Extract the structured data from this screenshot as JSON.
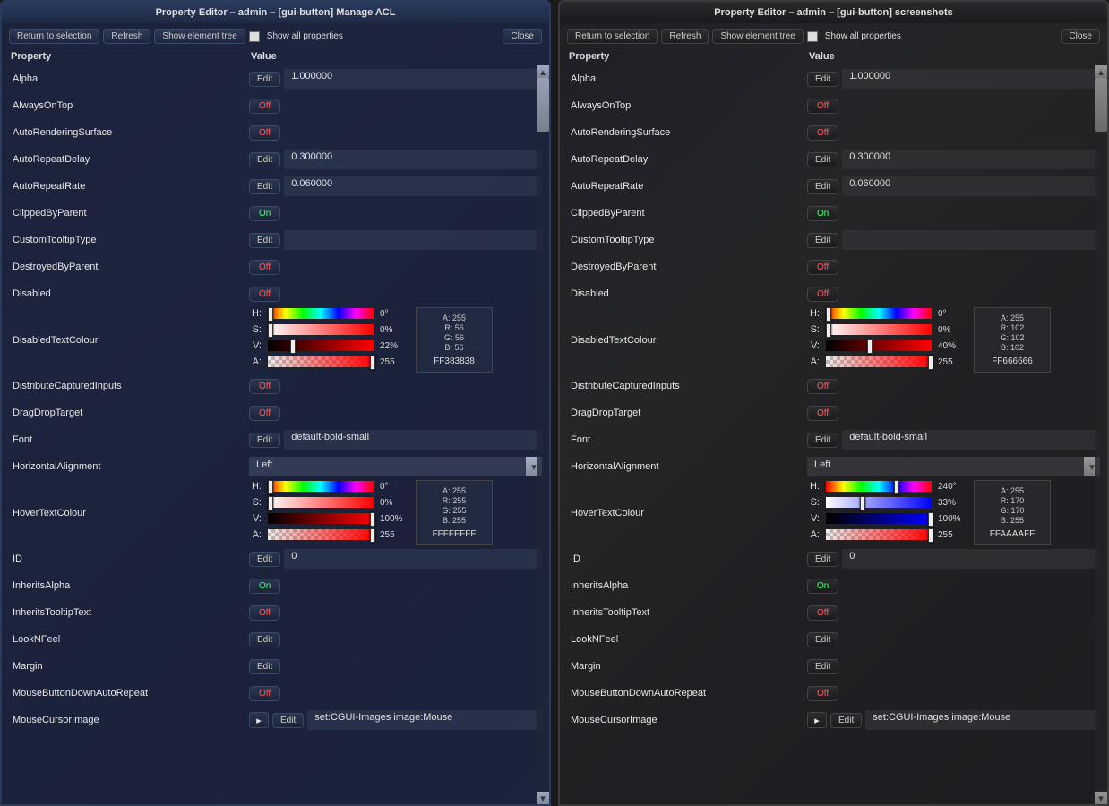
{
  "windows": [
    {
      "title": "Property Editor – admin – [gui-button] Manage ACL",
      "theme": "a",
      "toolbar": {
        "return": "Return to selection",
        "refresh": "Refresh",
        "tree": "Show element tree",
        "close": "Close",
        "showall": "Show all properties"
      },
      "headers": {
        "prop": "Property",
        "val": "Value"
      },
      "rows": [
        {
          "name": "Alpha",
          "type": "edit",
          "value": "1.000000"
        },
        {
          "name": "AlwaysOnTop",
          "type": "toggle",
          "state": "Off"
        },
        {
          "name": "AutoRenderingSurface",
          "type": "toggle",
          "state": "Off"
        },
        {
          "name": "AutoRepeatDelay",
          "type": "edit",
          "value": "0.300000"
        },
        {
          "name": "AutoRepeatRate",
          "type": "edit",
          "value": "0.060000"
        },
        {
          "name": "ClippedByParent",
          "type": "toggle",
          "state": "On"
        },
        {
          "name": "CustomTooltipType",
          "type": "edit",
          "value": ""
        },
        {
          "name": "DestroyedByParent",
          "type": "toggle",
          "state": "Off"
        },
        {
          "name": "Disabled",
          "type": "toggle",
          "state": "Off"
        },
        {
          "name": "DisabledTextColour",
          "type": "color",
          "h": {
            "val": "0°",
            "pos": 0
          },
          "s": {
            "val": "0%",
            "pos": 0
          },
          "v": {
            "val": "22%",
            "pos": 22
          },
          "a": {
            "val": "255",
            "pos": 100
          },
          "argb": {
            "a": "A: 255",
            "r": "R:   56",
            "g": "G:   56",
            "b": "B:   56"
          },
          "hex": "FF383838",
          "sgrad": "linear-gradient(90deg,#fff,#ff0000)",
          "vgrad": "linear-gradient(90deg,#000,#ff0000)"
        },
        {
          "name": "DistributeCapturedInputs",
          "type": "toggle",
          "state": "Off"
        },
        {
          "name": "DragDropTarget",
          "type": "toggle",
          "state": "Off"
        },
        {
          "name": "Font",
          "type": "edit",
          "value": "default-bold-small"
        },
        {
          "name": "HorizontalAlignment",
          "type": "select",
          "value": "Left"
        },
        {
          "name": "HoverTextColour",
          "type": "color",
          "h": {
            "val": "0°",
            "pos": 0
          },
          "s": {
            "val": "0%",
            "pos": 0
          },
          "v": {
            "val": "100%",
            "pos": 100
          },
          "a": {
            "val": "255",
            "pos": 100
          },
          "argb": {
            "a": "A: 255",
            "r": "R: 255",
            "g": "G: 255",
            "b": "B: 255"
          },
          "hex": "FFFFFFFF",
          "sgrad": "linear-gradient(90deg,#fff,#ff0000)",
          "vgrad": "linear-gradient(90deg,#000,#ff0000)"
        },
        {
          "name": "ID",
          "type": "edit",
          "value": "0"
        },
        {
          "name": "InheritsAlpha",
          "type": "toggle",
          "state": "On"
        },
        {
          "name": "InheritsTooltipText",
          "type": "toggle",
          "state": "Off"
        },
        {
          "name": "LookNFeel",
          "type": "editonly"
        },
        {
          "name": "Margin",
          "type": "editonly"
        },
        {
          "name": "MouseButtonDownAutoRepeat",
          "type": "toggle",
          "state": "Off"
        },
        {
          "name": "MouseCursorImage",
          "type": "flagedit",
          "value": "set:CGUI-Images image:Mouse"
        }
      ]
    },
    {
      "title": "Property Editor – admin – [gui-button] screenshots",
      "theme": "b",
      "toolbar": {
        "return": "Return to selection",
        "refresh": "Refresh",
        "tree": "Show element tree",
        "close": "Close",
        "showall": "Show all properties"
      },
      "headers": {
        "prop": "Property",
        "val": "Value"
      },
      "rows": [
        {
          "name": "Alpha",
          "type": "edit",
          "value": "1.000000"
        },
        {
          "name": "AlwaysOnTop",
          "type": "toggle",
          "state": "Off"
        },
        {
          "name": "AutoRenderingSurface",
          "type": "toggle",
          "state": "Off"
        },
        {
          "name": "AutoRepeatDelay",
          "type": "edit",
          "value": "0.300000"
        },
        {
          "name": "AutoRepeatRate",
          "type": "edit",
          "value": "0.060000"
        },
        {
          "name": "ClippedByParent",
          "type": "toggle",
          "state": "On"
        },
        {
          "name": "CustomTooltipType",
          "type": "edit",
          "value": ""
        },
        {
          "name": "DestroyedByParent",
          "type": "toggle",
          "state": "Off"
        },
        {
          "name": "Disabled",
          "type": "toggle",
          "state": "Off"
        },
        {
          "name": "DisabledTextColour",
          "type": "color",
          "h": {
            "val": "0°",
            "pos": 0
          },
          "s": {
            "val": "0%",
            "pos": 0
          },
          "v": {
            "val": "40%",
            "pos": 40
          },
          "a": {
            "val": "255",
            "pos": 100
          },
          "argb": {
            "a": "A: 255",
            "r": "R: 102",
            "g": "G: 102",
            "b": "B: 102"
          },
          "hex": "FF666666",
          "sgrad": "linear-gradient(90deg,#fff,#ff0000)",
          "vgrad": "linear-gradient(90deg,#000,#ff0000)"
        },
        {
          "name": "DistributeCapturedInputs",
          "type": "toggle",
          "state": "Off"
        },
        {
          "name": "DragDropTarget",
          "type": "toggle",
          "state": "Off"
        },
        {
          "name": "Font",
          "type": "edit",
          "value": "default-bold-small"
        },
        {
          "name": "HorizontalAlignment",
          "type": "select",
          "value": "Left"
        },
        {
          "name": "HoverTextColour",
          "type": "color",
          "h": {
            "val": "240°",
            "pos": 67
          },
          "s": {
            "val": "33%",
            "pos": 33
          },
          "v": {
            "val": "100%",
            "pos": 100
          },
          "a": {
            "val": "255",
            "pos": 100
          },
          "argb": {
            "a": "A: 255",
            "r": "R: 170",
            "g": "G: 170",
            "b": "B: 255"
          },
          "hex": "FFAAAAFF",
          "sgrad": "linear-gradient(90deg,#fff,#0000ff)",
          "vgrad": "linear-gradient(90deg,#000,#0000ff)"
        },
        {
          "name": "ID",
          "type": "edit",
          "value": "0"
        },
        {
          "name": "InheritsAlpha",
          "type": "toggle",
          "state": "On"
        },
        {
          "name": "InheritsTooltipText",
          "type": "toggle",
          "state": "Off"
        },
        {
          "name": "LookNFeel",
          "type": "editonly"
        },
        {
          "name": "Margin",
          "type": "editonly"
        },
        {
          "name": "MouseButtonDownAutoRepeat",
          "type": "toggle",
          "state": "Off"
        },
        {
          "name": "MouseCursorImage",
          "type": "flagedit",
          "value": "set:CGUI-Images image:Mouse"
        }
      ]
    }
  ],
  "labels": {
    "edit": "Edit",
    "on": "On",
    "off": "Off",
    "h": "H:",
    "s": "S:",
    "v": "V:",
    "a": "A:"
  }
}
